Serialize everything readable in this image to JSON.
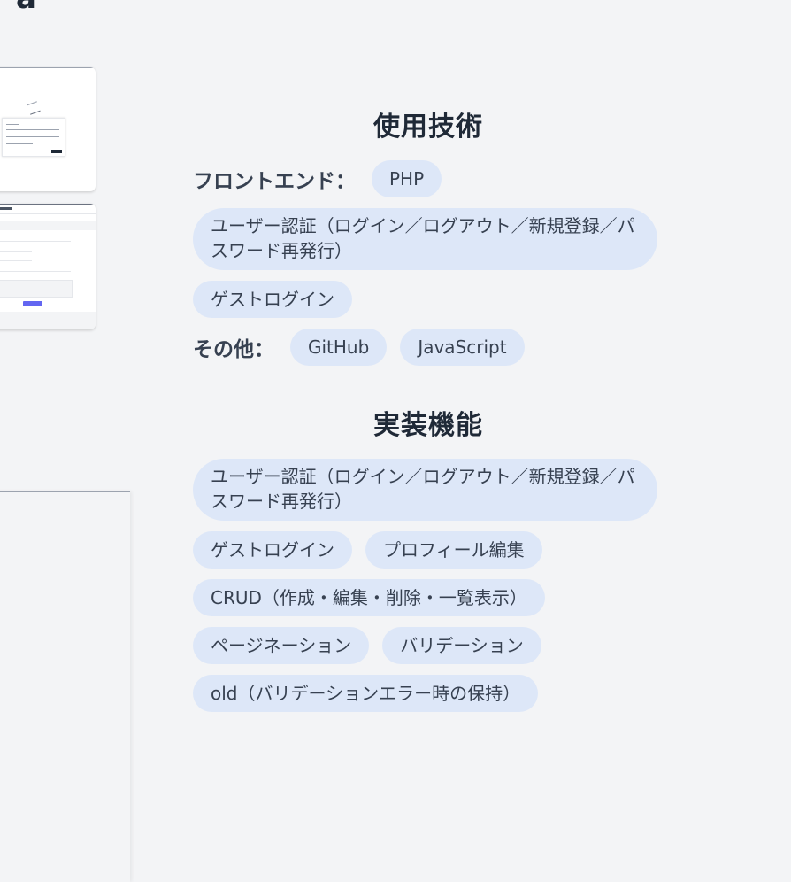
{
  "page": {
    "top_heading_fragment": "a"
  },
  "tech_section": {
    "title": "使用技術",
    "frontend_label": "フロントエンド：",
    "frontend_items": [
      "PHP",
      "ユーザー認証（ログイン／ログアウト／新規登録／パスワード再発行）",
      "ゲストログイン"
    ],
    "other_label": "その他：",
    "other_items": [
      "GitHub",
      "JavaScript"
    ]
  },
  "features_section": {
    "title": "実装機能",
    "items": [
      "ユーザー認証（ログイン／ログアウト／新規登録／パスワード再発行）",
      "ゲストログイン",
      "プロフィール編集",
      "CRUD（作成・編集・削除・一覧表示）",
      "ページネーション",
      "バリデーション",
      "old（バリデーションエラー時の保持）"
    ]
  },
  "colors": {
    "background": "#f3f4f6",
    "pill_background": "#dde7f8",
    "heading_text": "#1f2937",
    "accent_button": "#6366f1"
  }
}
